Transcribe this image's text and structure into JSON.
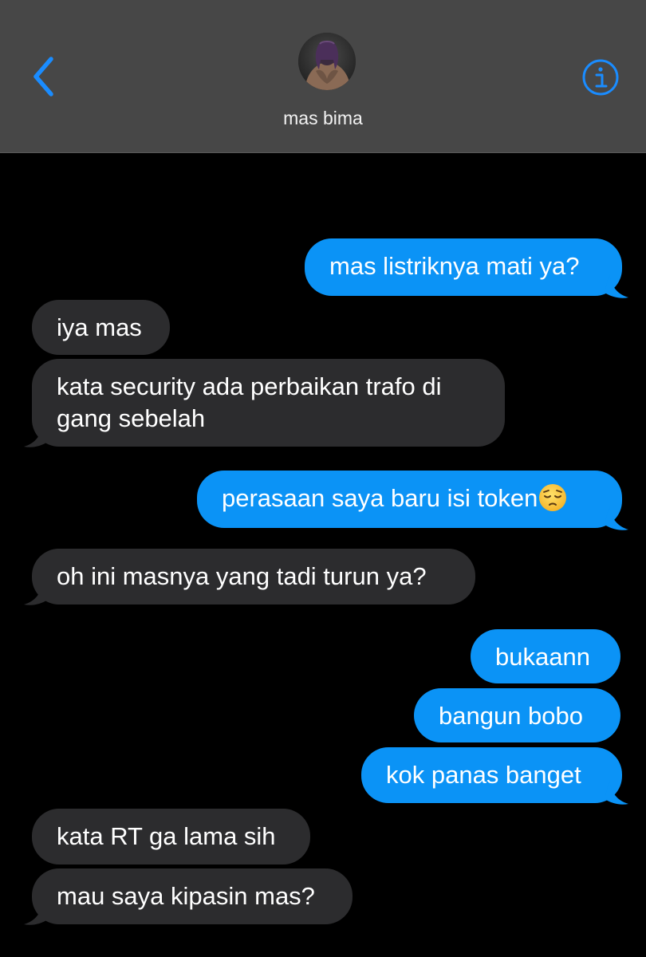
{
  "header": {
    "contact_name": "mas bima",
    "back_icon": "chevron-left-icon",
    "info_icon": "info-circle-icon",
    "accent_color": "#1a8cff"
  },
  "messages": [
    {
      "direction": "outgoing",
      "text": "mas listriknya mati ya?"
    },
    {
      "direction": "incoming",
      "text": "iya mas"
    },
    {
      "direction": "incoming",
      "line1": "kata security ada perbaikan trafo di",
      "line2": "gang sebelah"
    },
    {
      "direction": "outgoing",
      "text": "perasaan saya baru isi token",
      "emoji": "pensive-face-emoji"
    },
    {
      "direction": "incoming",
      "text": "oh ini masnya yang tadi turun ya?"
    },
    {
      "direction": "outgoing",
      "text": "bukaann"
    },
    {
      "direction": "outgoing",
      "text": "bangun bobo"
    },
    {
      "direction": "outgoing",
      "text": "kok panas banget"
    },
    {
      "direction": "incoming",
      "text": "kata RT ga lama sih"
    },
    {
      "direction": "incoming",
      "text": "mau saya kipasin mas?"
    }
  ],
  "colors": {
    "outgoing_bubble": "#1a8cff",
    "incoming_bubble": "#2c2c2e",
    "header_background": "#474747",
    "thread_background": "#000000"
  }
}
